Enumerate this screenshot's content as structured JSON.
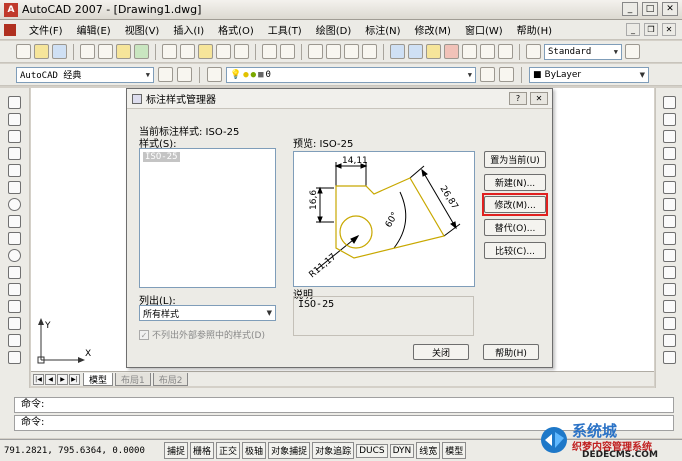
{
  "window": {
    "title": "AutoCAD 2007 - [Drawing1.dwg]"
  },
  "menu": [
    "文件(F)",
    "编辑(E)",
    "视图(V)",
    "插入(I)",
    "格式(O)",
    "工具(T)",
    "绘图(D)",
    "标注(N)",
    "修改(M)",
    "窗口(W)",
    "帮助(H)"
  ],
  "toolbar": {
    "text_style": "Standard",
    "workspace": "AutoCAD 经典",
    "layer": "0",
    "color": "ByLayer"
  },
  "dialog": {
    "title": "标注样式管理器",
    "current_style_label": "当前标注样式: ISO-25",
    "styles_label": "样式(S):",
    "styles": [
      "ISO-25"
    ],
    "preview_label": "预览: ISO-25",
    "list_label": "列出(L):",
    "list_value": "所有样式",
    "exclude_xref_label": "不列出外部参照中的样式(D)",
    "description_label": "说明",
    "description_value": "ISO-25",
    "buttons": {
      "set_current": "置为当前(U)",
      "new": "新建(N)...",
      "modify": "修改(M)...",
      "override": "替代(O)...",
      "compare": "比较(C)...",
      "close": "关闭",
      "help": "帮助(H)"
    },
    "preview_dims": {
      "top": "14,11",
      "left": "16,6",
      "diag": "26,87",
      "angle": "60°",
      "radius": "R11,17"
    },
    "highlight_color": "#e02020"
  },
  "layout_tabs": [
    "模型",
    "布局1",
    "布局2"
  ],
  "ucs": {
    "x": "X",
    "y": "Y"
  },
  "command": {
    "line1": "命令:",
    "line2": "命令:"
  },
  "status": {
    "coords": "791.2821, 795.6364, 0.0000",
    "toggles": [
      "捕捉",
      "栅格",
      "正交",
      "极轴",
      "对象捕捉",
      "对象追踪",
      "DUCS",
      "DYN",
      "线宽",
      "模型"
    ]
  },
  "watermark": {
    "site": "织梦内容管理系统",
    "url": "DEDECMS.COM",
    "brand": "系统城"
  }
}
